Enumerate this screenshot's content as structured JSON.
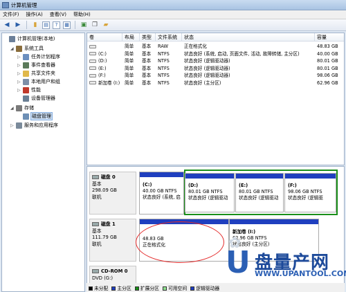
{
  "window": {
    "title": "计算机管理"
  },
  "menu": [
    "文件(F)",
    "操作(A)",
    "查看(V)",
    "帮助(H)"
  ],
  "tree": [
    {
      "label": "计算机管理(本地)",
      "level": 0,
      "expander": "",
      "icon": "computer-management-icon",
      "color": "#6b7f99"
    },
    {
      "label": "系统工具",
      "level": 1,
      "expander": "◢",
      "icon": "tools-icon",
      "color": "#8a6d3b"
    },
    {
      "label": "任务计划程序",
      "level": 2,
      "expander": "▷",
      "icon": "task-scheduler-icon",
      "color": "#6b8fbf"
    },
    {
      "label": "事件查看器",
      "level": 2,
      "expander": "▷",
      "icon": "event-viewer-icon",
      "color": "#5a7a5a"
    },
    {
      "label": "共享文件夹",
      "level": 2,
      "expander": "▷",
      "icon": "shared-folder-icon",
      "color": "#e0b84a"
    },
    {
      "label": "本地用户和组",
      "level": 2,
      "expander": "▷",
      "icon": "users-icon",
      "color": "#7d8fa8"
    },
    {
      "label": "性能",
      "level": 2,
      "expander": "▷",
      "icon": "performance-icon",
      "color": "#c0392b"
    },
    {
      "label": "设备管理器",
      "level": 2,
      "expander": "",
      "icon": "device-manager-icon",
      "color": "#6a7f94"
    },
    {
      "label": "存储",
      "level": 1,
      "expander": "◢",
      "icon": "storage-icon",
      "color": "#7a7a7a"
    },
    {
      "label": "磁盘管理",
      "level": 2,
      "expander": "",
      "icon": "disk-management-icon",
      "color": "#6d8fb5",
      "selected": true
    },
    {
      "label": "服务和应用程序",
      "level": 1,
      "expander": "▷",
      "icon": "services-icon",
      "color": "#7a8a9a"
    }
  ],
  "volume_table": {
    "columns": [
      "卷",
      "布局",
      "类型",
      "文件系统",
      "状态",
      "容量"
    ],
    "rows": [
      [
        "",
        "简单",
        "基本",
        "RAW",
        "正在格式化",
        "48.83 GB"
      ],
      [
        "(C:)",
        "简单",
        "基本",
        "NTFS",
        "状态良好 (系统, 启动, 页面文件, 活动, 故障转储, 主分区)",
        "40.00 GB"
      ],
      [
        "(D:)",
        "简单",
        "基本",
        "NTFS",
        "状态良好 (逻辑驱动器)",
        "80.01 GB"
      ],
      [
        "(E:)",
        "简单",
        "基本",
        "NTFS",
        "状态良好 (逻辑驱动器)",
        "80.01 GB"
      ],
      [
        "(F:)",
        "简单",
        "基本",
        "NTFS",
        "状态良好 (逻辑驱动器)",
        "98.06 GB"
      ],
      [
        "新加卷 (I:)",
        "简单",
        "基本",
        "NTFS",
        "状态良好 (主分区)",
        "62.96 GB"
      ]
    ]
  },
  "disks": [
    {
      "name": "磁盘 0",
      "type": "基本",
      "size": "298.09 GB",
      "status": "联机",
      "partitions": [
        {
          "name": "(C:)",
          "size": "40.00 GB NTFS",
          "status": "状态良好 (系统, 启",
          "kind": "primary"
        },
        {
          "name": "(D:)",
          "size": "80.01 GB NTFS",
          "status": "状态良好 (逻辑驱动",
          "kind": "logical"
        },
        {
          "name": "(E:)",
          "size": "80.01 GB NTFS",
          "status": "状态良好 (逻辑驱动",
          "kind": "logical"
        },
        {
          "name": "(F:)",
          "size": "98.06 GB NTFS",
          "status": "状态良好 (逻辑驱",
          "kind": "logical"
        }
      ]
    },
    {
      "name": "磁盘 1",
      "type": "基本",
      "size": "111.79 GB",
      "status": "联机",
      "partitions": [
        {
          "name": "",
          "size": "48.83 GB",
          "status": "正在格式化",
          "kind": "primary"
        },
        {
          "name": "新加卷 (I:)",
          "size": "62.96 GB NTFS",
          "status": "状态良好 (主分区)",
          "kind": "primary"
        }
      ]
    },
    {
      "name": "CD-ROM 0",
      "type": "DVD (G:)",
      "size": "",
      "status": ""
    }
  ],
  "legend": [
    {
      "label": "未分配",
      "color": "#000000"
    },
    {
      "label": "主分区",
      "color": "#1f3fbf"
    },
    {
      "label": "扩展分区",
      "color": "#1a8f1a"
    },
    {
      "label": "可用空间",
      "color": "#8fe08f"
    },
    {
      "label": "逻辑驱动器",
      "color": "#1f3fbf"
    }
  ],
  "watermark": {
    "letter": "U",
    "text": "盘量产网",
    "url": "WWW.UPANTOOL.COM"
  },
  "colors": {
    "primary_bar": "#1f3fbf",
    "logical_bar": "#1f3fbf",
    "extended_border": "#1a8f1a",
    "highlight": "#e42b2b"
  }
}
